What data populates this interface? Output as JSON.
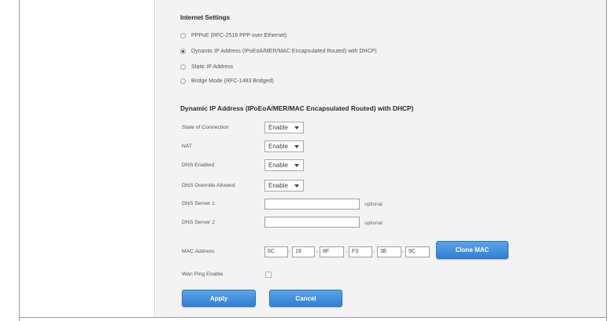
{
  "internet_settings": {
    "title": "Internet Settings",
    "options": [
      {
        "label": "PPPoE (RFC-2516 PPP over Ethernet)",
        "checked": false
      },
      {
        "label": "Dynamic IP Address (IPoEoA/MER/MAC Encapsulated Routed) with DHCP)",
        "checked": true
      },
      {
        "label": "Static IP Address",
        "checked": false
      },
      {
        "label": "Bridge Mode (RFC-1483 Bridged)",
        "checked": false
      }
    ]
  },
  "dynamic_section": {
    "title": "Dynamic IP Address (IPoEoA/MER/MAC Encapsulated Routed) with DHCP)",
    "state_label": "State of Connection",
    "state_value": "Enable",
    "nat_label": "NAT",
    "nat_value": "Enable",
    "dns_enabled_label": "DNS Enabled",
    "dns_enabled_value": "Enable",
    "dns_override_label": "DNS Override Allowed",
    "dns_override_value": "Enable",
    "dns1_label": "DNS Server 1",
    "dns1_value": "",
    "dns1_optional": "optional",
    "dns2_label": "DNS Server 2",
    "dns2_value": "",
    "dns2_optional": "optional",
    "mac_label": "MAC Address",
    "mac_octets": [
      "6C",
      "19",
      "8F",
      "F3",
      "3E",
      "9C"
    ],
    "mac_separator": "-",
    "clone_mac_label": "Clone MAC",
    "wan_ping_label": "Wan Ping Enable",
    "wan_ping_checked": false
  },
  "buttons": {
    "apply": "Apply",
    "cancel": "Cancel"
  },
  "colors": {
    "button_blue": "#3a8ad9",
    "panel_bg": "#f3f3f3"
  }
}
